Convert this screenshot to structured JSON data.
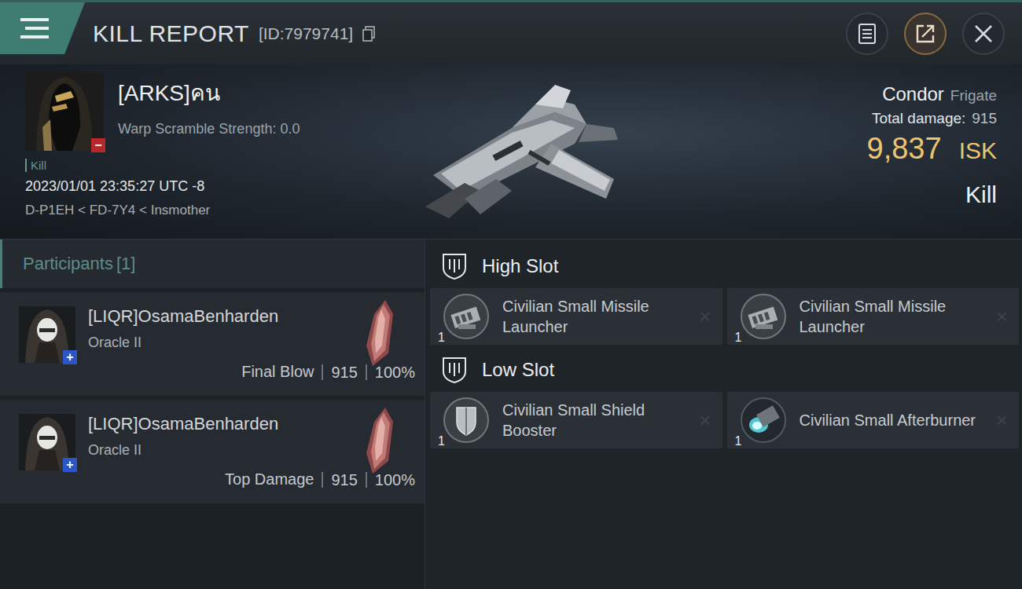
{
  "header": {
    "title": "KILL REPORT",
    "id": "[ID:7979741]"
  },
  "victim": {
    "name": "[ARKS]คน",
    "detail": "Warp Scramble Strength: 0.0",
    "badge": "−",
    "tag": "Kill",
    "time": "2023/01/01 23:35:27 UTC -8",
    "location": "D-P1EH < FD-7Y4 < Insmother"
  },
  "ship": {
    "name": "Condor",
    "class": "Frigate",
    "damage_label": "Total damage:",
    "damage": "915",
    "value": "9,837",
    "currency": "ISK",
    "result": "Kill"
  },
  "participants": {
    "title": "Participants",
    "count": "[1]",
    "rows": [
      {
        "name": "[LIQR]OsamaBenharden",
        "ship": "Oracle II",
        "badge": "+",
        "role": "Final Blow",
        "damage": "915",
        "share": "100%"
      },
      {
        "name": "[LIQR]OsamaBenharden",
        "ship": "Oracle II",
        "badge": "+",
        "role": "Top Damage",
        "damage": "915",
        "share": "100%"
      }
    ]
  },
  "slots": [
    {
      "title": "High Slot",
      "items": [
        {
          "name": "Civilian Small Missile Launcher",
          "quantity": "1",
          "mark": "×",
          "kind": "launcher"
        },
        {
          "name": "Civilian Small Missile Launcher",
          "quantity": "1",
          "mark": "×",
          "kind": "launcher"
        }
      ]
    },
    {
      "title": "Low Slot",
      "items": [
        {
          "name": "Civilian Small Shield Booster",
          "quantity": "1",
          "mark": "×",
          "kind": "shield"
        },
        {
          "name": "Civilian Small Afterburner",
          "quantity": "1",
          "mark": "×",
          "kind": "afterburner"
        }
      ]
    }
  ]
}
